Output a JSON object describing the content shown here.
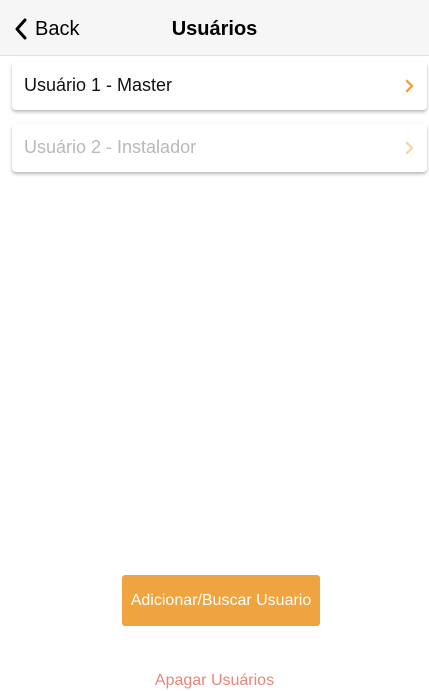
{
  "navbar": {
    "back_label": "Back",
    "title": "Usuários"
  },
  "users": [
    {
      "label": "Usuário 1 - Master",
      "enabled": true
    },
    {
      "label": "Usuário 2 - Instalador",
      "enabled": false
    }
  ],
  "actions": {
    "add_label": "Adicionar/Buscar Usuario",
    "delete_label": "Apagar Usuários"
  },
  "colors": {
    "accent": "#f0a43f",
    "accent_disabled": "#f8d6a8",
    "danger": "#e8857b",
    "navbar_bg": "#f6f6f6"
  },
  "icons": {
    "back": "chevron-left-icon",
    "row_chevron": "chevron-right-icon"
  }
}
